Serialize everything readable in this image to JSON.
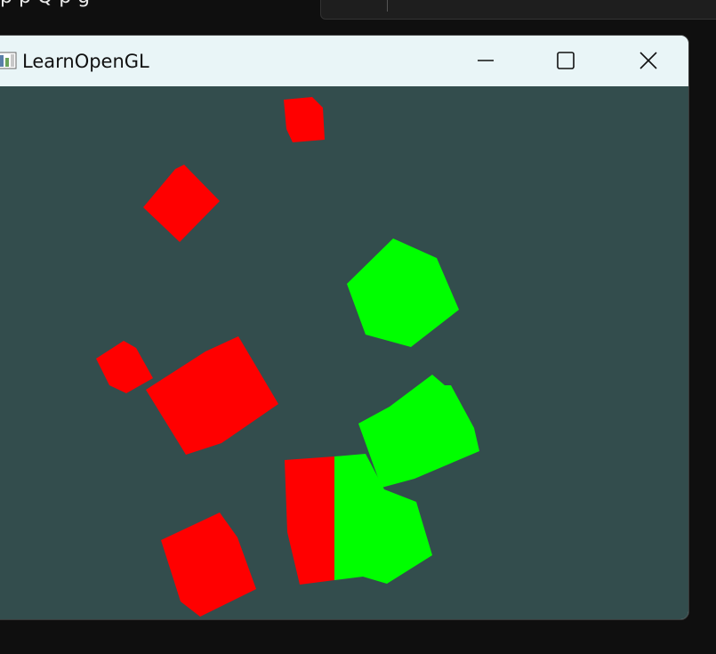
{
  "background_window": {
    "title_partial": "p   p  Q p  g"
  },
  "window": {
    "title": "LearnOpenGL",
    "controls": {
      "minimize": "minimize",
      "maximize": "maximize",
      "close": "close"
    },
    "clear_color": "#334d4d"
  },
  "scene": {
    "colors": {
      "red": "#ff0000",
      "green": "#00ff00"
    },
    "objects": [
      {
        "name": "red-cube-1",
        "color": "red"
      },
      {
        "name": "red-cube-2",
        "color": "red"
      },
      {
        "name": "green-cube-1",
        "color": "green"
      },
      {
        "name": "red-cube-3",
        "color": "red"
      },
      {
        "name": "red-cube-4",
        "color": "red"
      },
      {
        "name": "green-cube-2",
        "color": "green"
      },
      {
        "name": "red-cube-5",
        "color": "red"
      },
      {
        "name": "red-cube-6",
        "color": "red"
      },
      {
        "name": "green-cube-3",
        "color": "green"
      }
    ]
  }
}
